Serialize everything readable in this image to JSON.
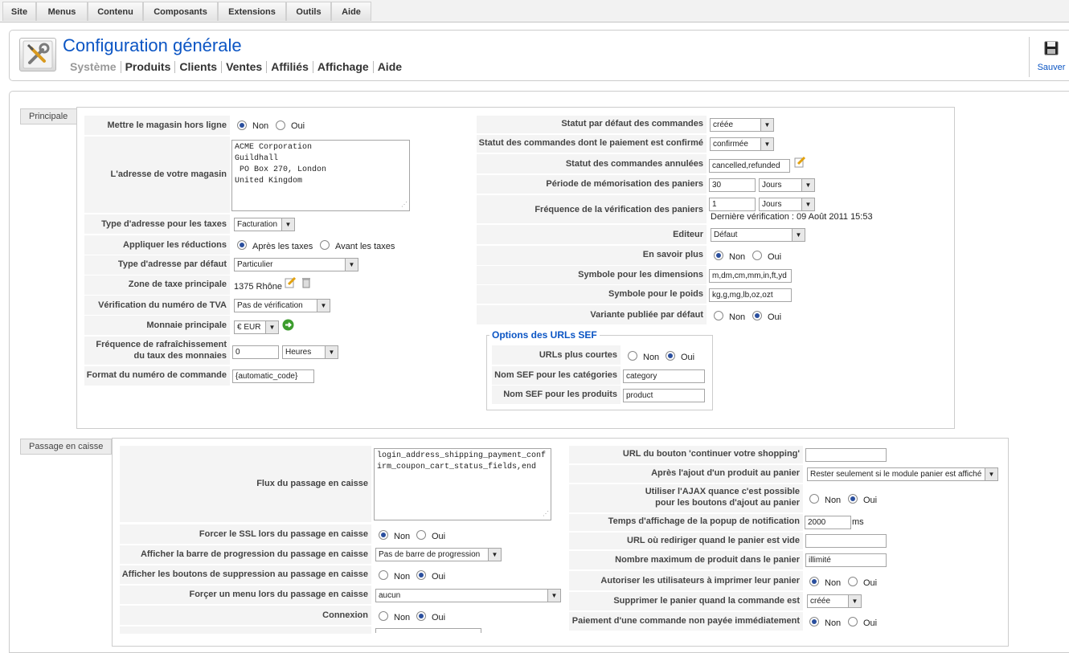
{
  "menubar": [
    "Site",
    "Menus",
    "Contenu",
    "Composants",
    "Extensions",
    "Outils",
    "Aide"
  ],
  "header": {
    "title": "Configuration générale",
    "subnav": [
      "Système",
      "Produits",
      "Clients",
      "Ventes",
      "Affiliés",
      "Affichage",
      "Aide"
    ],
    "save_label": "Sauver"
  },
  "principale": {
    "tab": "Principale",
    "offline_label": "Mettre le magasin hors ligne",
    "address_label": "L'adresse de votre magasin",
    "address_value": "ACME Corporation\nGuildhall\n PO Box 270, London\nUnited Kingdom",
    "tax_address_label": "Type d'adresse pour les taxes",
    "tax_address_value": "Facturation",
    "discount_label": "Appliquer les réductions",
    "discount_after": "Après les taxes",
    "discount_before": "Avant les taxes",
    "default_address_label": "Type d'adresse par défaut",
    "default_address_value": "Particulier",
    "tax_zone_label": "Zone de taxe principale",
    "tax_zone_value": "1375 Rhône",
    "vat_label": "Vérification du numéro de TVA",
    "vat_value": "Pas de vérification",
    "currency_label": "Monnaie principale",
    "currency_value": "€ EUR",
    "refresh_label_1": "Fréquence de rafraîchissement",
    "refresh_label_2": "du taux des monnaies",
    "refresh_value": "0",
    "refresh_unit": "Heures",
    "order_format_label": "Format du numéro de commande",
    "order_format_value": "{automatic_code}",
    "no": "Non",
    "yes": "Oui",
    "status_default_label": "Statut par défaut des commandes",
    "status_default_value": "créée",
    "status_paid_label": "Statut des commandes dont le paiement est confirmé",
    "status_paid_value": "confirmée",
    "status_cancelled_label": "Statut des commandes annulées",
    "status_cancelled_value": "cancelled,refunded",
    "cart_period_label": "Période de mémorisation des paniers",
    "cart_period_value": "30",
    "cart_period_unit": "Jours",
    "check_freq_label": "Fréquence de la vérification des paniers",
    "check_freq_value": "1",
    "check_freq_unit": "Jours",
    "last_check": "Dernière vérification : 09 Août 2011 15:53",
    "editor_label": "Editeur",
    "editor_value": "Défaut",
    "read_more_label": "En savoir plus",
    "dimension_label": "Symbole pour les dimensions",
    "dimension_value": "m,dm,cm,mm,in,ft,yd",
    "weight_label": "Symbole pour le poids",
    "weight_value": "kg,g,mg,lb,oz,ozt",
    "variant_label": "Variante publiée par défaut",
    "sef_legend": "Options des URLs SEF",
    "sef_short_label": "URLs plus courtes",
    "sef_cat_label": "Nom SEF pour les catégories",
    "sef_cat_value": "category",
    "sef_prod_label": "Nom SEF pour les produits",
    "sef_prod_value": "product"
  },
  "checkout": {
    "tab": "Passage en caisse",
    "flow_label": "Flux du passage en caisse",
    "flow_value": "login_address_shipping_payment_confirm_coupon_cart_status_fields,end",
    "ssl_label": "Forcer le SSL lors du passage en caisse",
    "progress_label": "Afficher la barre de progression du passage en caisse",
    "progress_value": "Pas de barre de progression",
    "delete_label": "Afficher les boutons de suppression au passage en caisse",
    "menu_label": "Forçer un menu lors du passage en caisse",
    "menu_value": "aucun",
    "login_label": "Connexion",
    "continue_url_label": "URL du bouton 'continuer votre shopping'",
    "after_add_label": "Après l'ajout d'un produit au panier",
    "after_add_value": "Rester seulement si le module panier est affiché",
    "ajax_label_1": "Utiliser l'AJAX quance c'est possible",
    "ajax_label_2": "pour les boutons d'ajout au panier",
    "popup_label": "Temps d'affichage de la popup de notification",
    "popup_value": "2000",
    "popup_unit": "ms",
    "empty_url_label": "URL où rediriger quand le panier est vide",
    "max_products_label": "Nombre maximum de produit dans le panier",
    "max_products_value": "illimité",
    "print_label": "Autoriser les utilisateurs à imprimer leur panier",
    "delete_cart_label": "Supprimer le panier quand la commande est",
    "delete_cart_value": "créée",
    "unpaid_label": "Paiement d'une commande non payée immédiatement"
  }
}
